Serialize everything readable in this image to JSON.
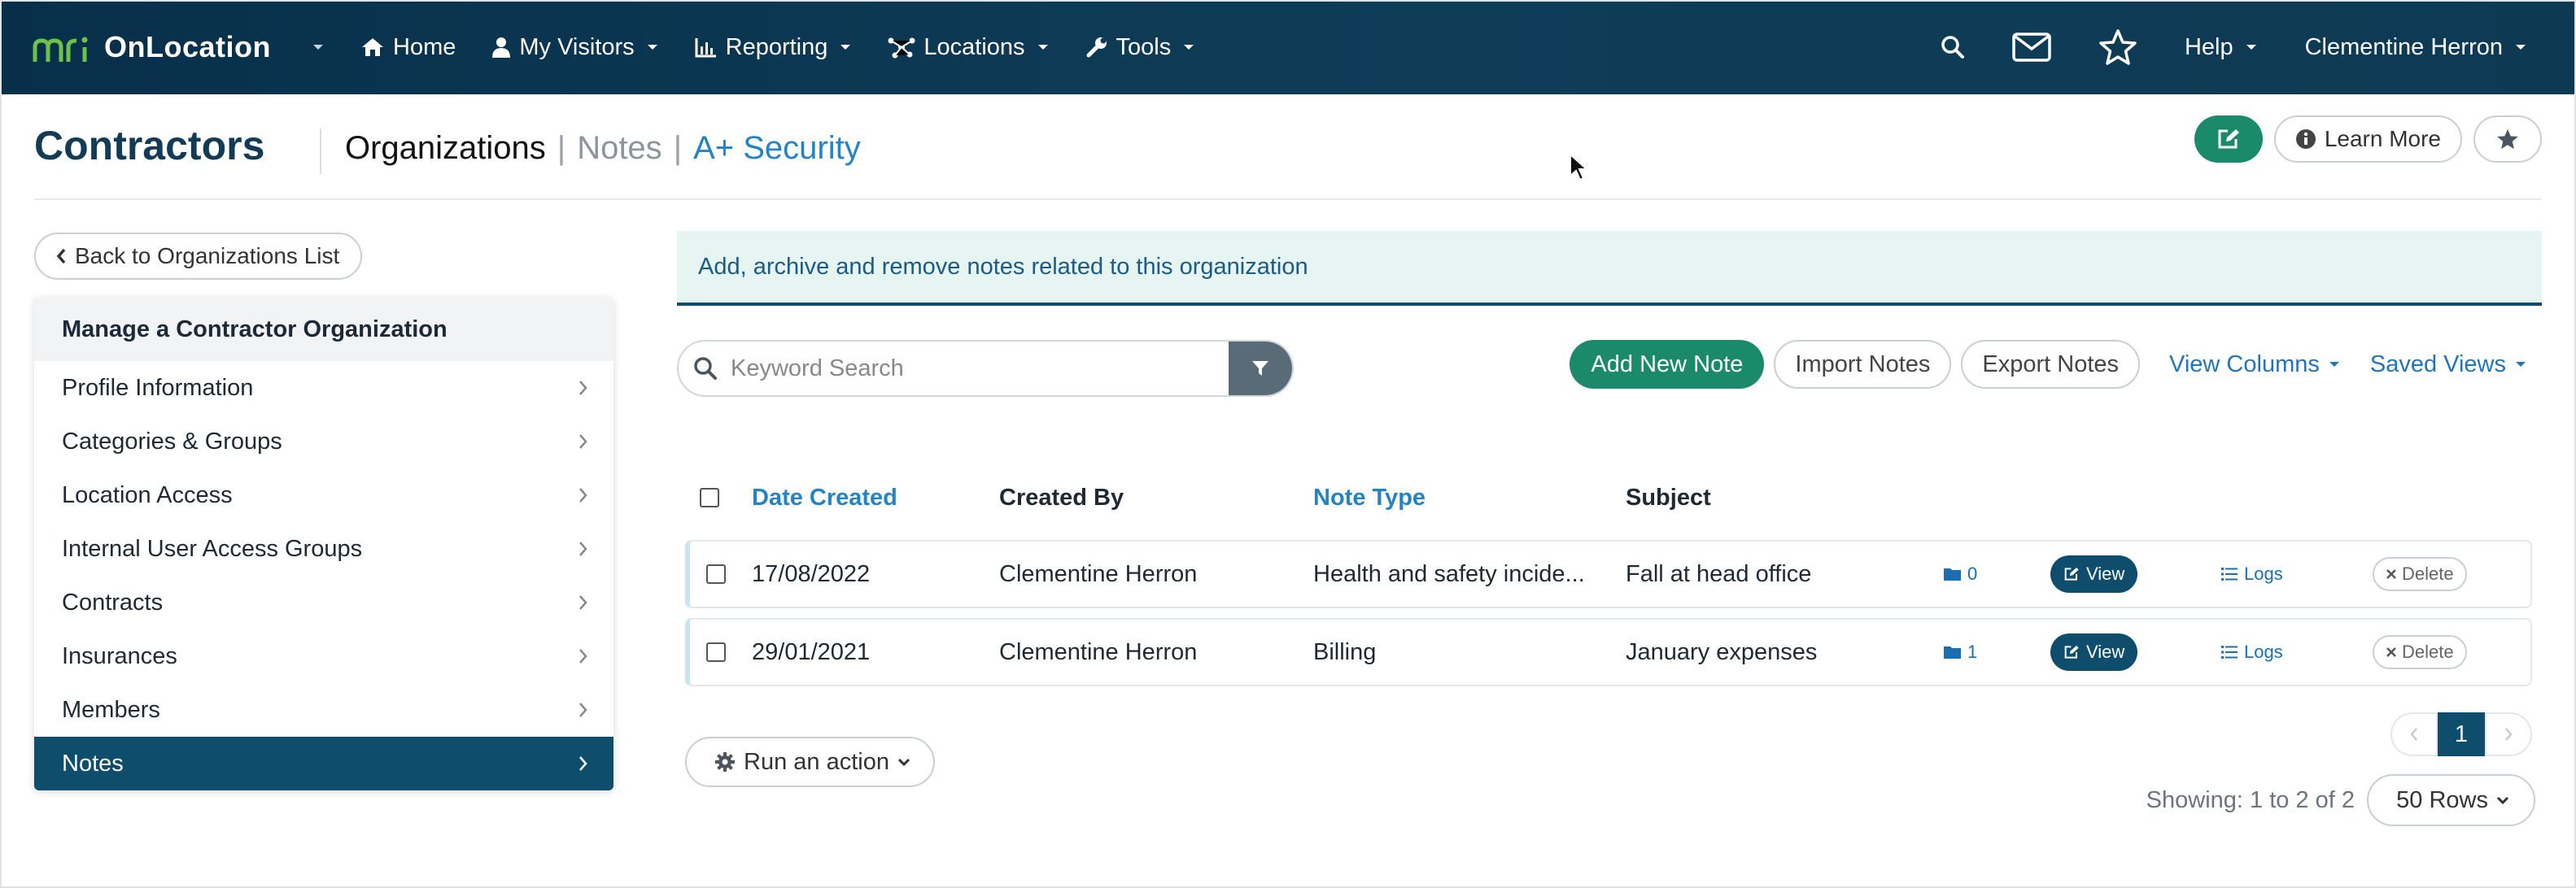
{
  "nav": {
    "brand_logo": "mri",
    "brand_name": "OnLocation",
    "items": [
      {
        "label": "Home",
        "icon": "home-icon"
      },
      {
        "label": "My Visitors",
        "icon": "user-icon"
      },
      {
        "label": "Reporting",
        "icon": "bar-chart-icon"
      },
      {
        "label": "Locations",
        "icon": "network-icon"
      },
      {
        "label": "Tools",
        "icon": "wrench-icon"
      }
    ],
    "help_label": "Help",
    "user_name": "Clementine Herron"
  },
  "header": {
    "title": "Contractors",
    "tabs": [
      {
        "label": "Organizations",
        "state": "current"
      },
      {
        "label": "Notes",
        "state": "muted"
      },
      {
        "label": "A+ Security",
        "state": "link"
      }
    ],
    "learn_more_label": "Learn More"
  },
  "sidebar": {
    "back_label": "Back to Organizations List",
    "heading": "Manage a Contractor Organization",
    "items": [
      {
        "label": "Profile Information"
      },
      {
        "label": "Categories & Groups"
      },
      {
        "label": "Location Access"
      },
      {
        "label": "Internal User Access Groups"
      },
      {
        "label": "Contracts"
      },
      {
        "label": "Insurances"
      },
      {
        "label": "Members"
      },
      {
        "label": "Notes",
        "active": true
      }
    ]
  },
  "main": {
    "info_text": "Add, archive and remove notes related to this organization",
    "search_placeholder": "Keyword Search",
    "add_label": "Add New Note",
    "import_label": "Import Notes",
    "export_label": "Export Notes",
    "view_columns_label": "View Columns",
    "saved_views_label": "Saved Views",
    "columns": [
      "Date Created",
      "Created By",
      "Note Type",
      "Subject"
    ],
    "rows": [
      {
        "date": "17/08/2022",
        "created_by": "Clementine Herron",
        "note_type": "Health and safety incide...",
        "subject": "Fall at head office",
        "files": "0",
        "view": "View",
        "logs": "Logs",
        "delete": "Delete"
      },
      {
        "date": "29/01/2021",
        "created_by": "Clementine Herron",
        "note_type": "Billing",
        "subject": "January expenses",
        "files": "1",
        "view": "View",
        "logs": "Logs",
        "delete": "Delete"
      }
    ],
    "run_action_label": "Run an action",
    "page": "1",
    "showing_text": "Showing: 1 to 2 of 2",
    "rows_label": "50 Rows"
  },
  "colors": {
    "nav_bg": "#0d3953",
    "accent_green": "#1a8a6b",
    "active_blue": "#0e4d6c",
    "link_blue": "#2383c4"
  }
}
